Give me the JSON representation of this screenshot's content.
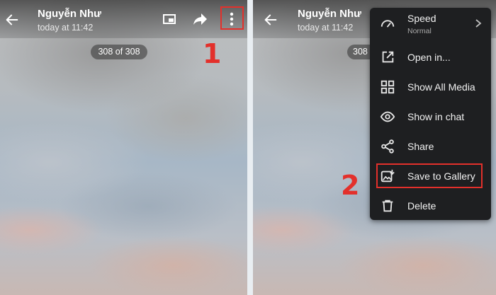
{
  "viewer": {
    "sender": "Nguyễn Như",
    "time": "today at 11:42",
    "counter": "308 of 308",
    "counter_partial": "308"
  },
  "annotations": {
    "step1": "1",
    "step2": "2",
    "highlight_color": "#e3302b"
  },
  "menu": {
    "items": [
      {
        "label": "Speed",
        "sub": "Normal",
        "icon": "speed-gauge-icon"
      },
      {
        "label": "Open in...",
        "icon": "open-external-icon"
      },
      {
        "label": "Show All Media",
        "icon": "grid-icon"
      },
      {
        "label": "Show in chat",
        "icon": "eye-icon"
      },
      {
        "label": "Share",
        "icon": "share-icon"
      },
      {
        "label": "Save to Gallery",
        "icon": "save-gallery-icon"
      },
      {
        "label": "Delete",
        "icon": "trash-icon"
      }
    ]
  }
}
